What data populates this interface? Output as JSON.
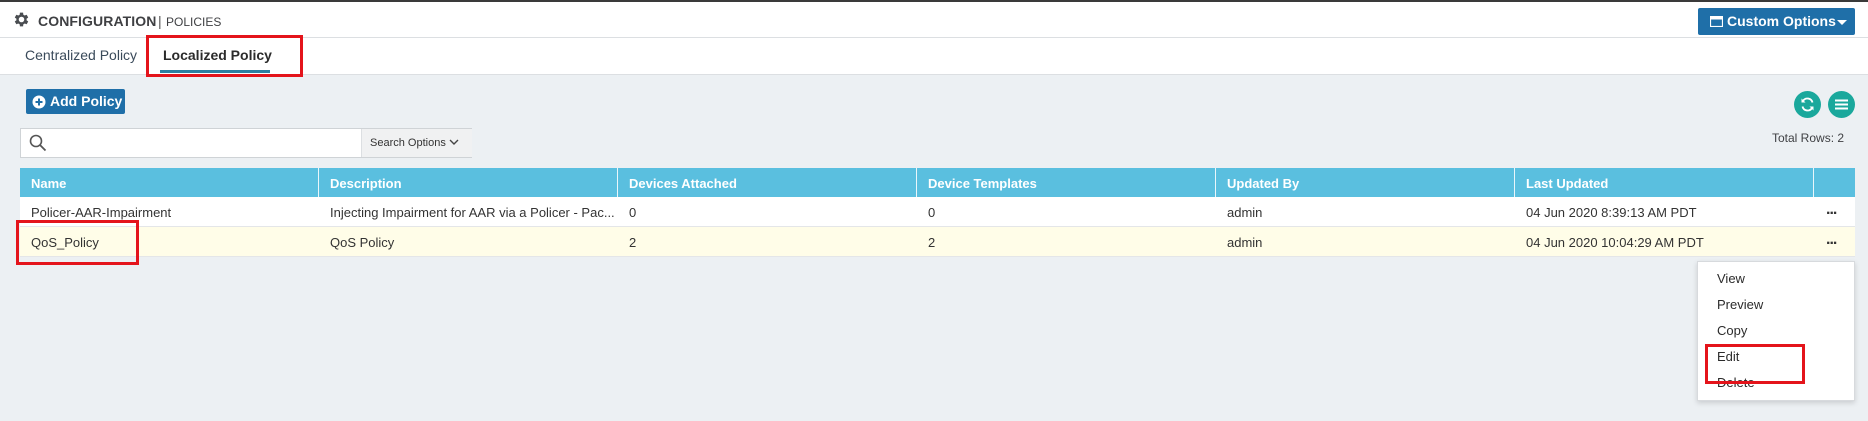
{
  "header": {
    "section_title": "CONFIGURATION",
    "separator": "|",
    "page_title": "POLICIES",
    "custom_options_label": "Custom Options",
    "gear_icon": "gear-icon"
  },
  "tabs": [
    {
      "label": "Centralized Policy",
      "active": false
    },
    {
      "label": "Localized Policy",
      "active": true
    }
  ],
  "toolbar": {
    "add_policy_label": "Add Policy",
    "refresh_icon": "refresh-icon",
    "menu_icon": "hamburger-menu-icon"
  },
  "search": {
    "value": "",
    "placeholder": "",
    "options_label": "Search Options"
  },
  "total_rows_text": "Total Rows: 2",
  "table": {
    "columns": [
      "Name",
      "Description",
      "Devices Attached",
      "Device Templates",
      "Updated By",
      "Last Updated"
    ],
    "rows": [
      [
        "Policer-AAR-Impairment",
        "Injecting Impairment for AAR via a Policer - Pac...",
        "0",
        "0",
        "admin",
        "04 Jun 2020 8:39:13 AM PDT"
      ],
      [
        "QoS_Policy",
        "QoS Policy",
        "2",
        "2",
        "admin",
        "04 Jun 2020 10:04:29 AM PDT"
      ]
    ],
    "row_action_label": "..."
  },
  "context_menu": {
    "items": [
      "View",
      "Preview",
      "Copy",
      "Edit",
      "Delete"
    ]
  },
  "colors": {
    "header_blue": "#1f6fa8",
    "table_header": "#5abfdf",
    "teal": "#1aa89c",
    "highlight_red": "#e4141b",
    "selected_row": "#fffde8"
  }
}
